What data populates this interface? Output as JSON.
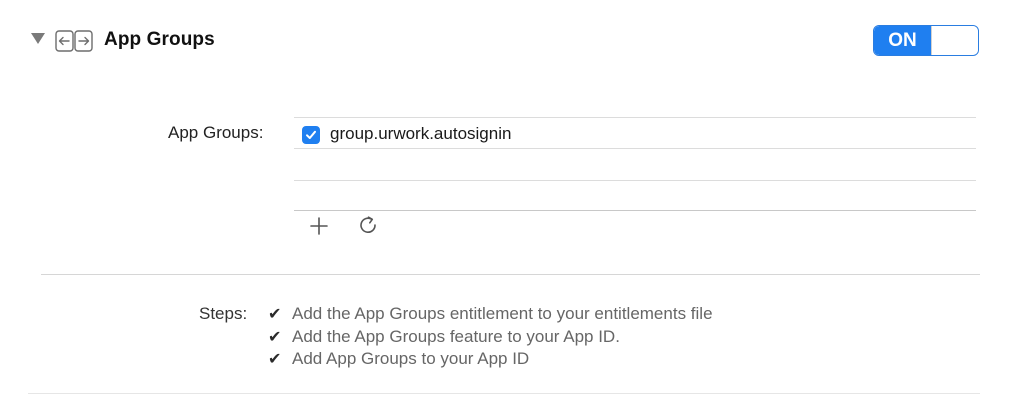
{
  "section": {
    "title": "App Groups",
    "toggle_label": "ON",
    "capability_icon": "app-groups-arrows-icon",
    "disclosure_icon": "disclosure-triangle-down-icon"
  },
  "groups": {
    "label": "App Groups:",
    "items": [
      {
        "name": "group.urwork.autosignin",
        "checked": true
      }
    ],
    "add_icon": "plus-icon",
    "refresh_icon": "refresh-icon"
  },
  "steps": {
    "label": "Steps:",
    "items": [
      "Add the App Groups entitlement to your entitlements file",
      "Add the App Groups feature to your App ID.",
      "Add App Groups to your App ID"
    ],
    "checkmark": "✔"
  },
  "colors": {
    "accent": "#1f7ff0",
    "divider": "#dcdcdc",
    "muted_text": "#666666"
  }
}
